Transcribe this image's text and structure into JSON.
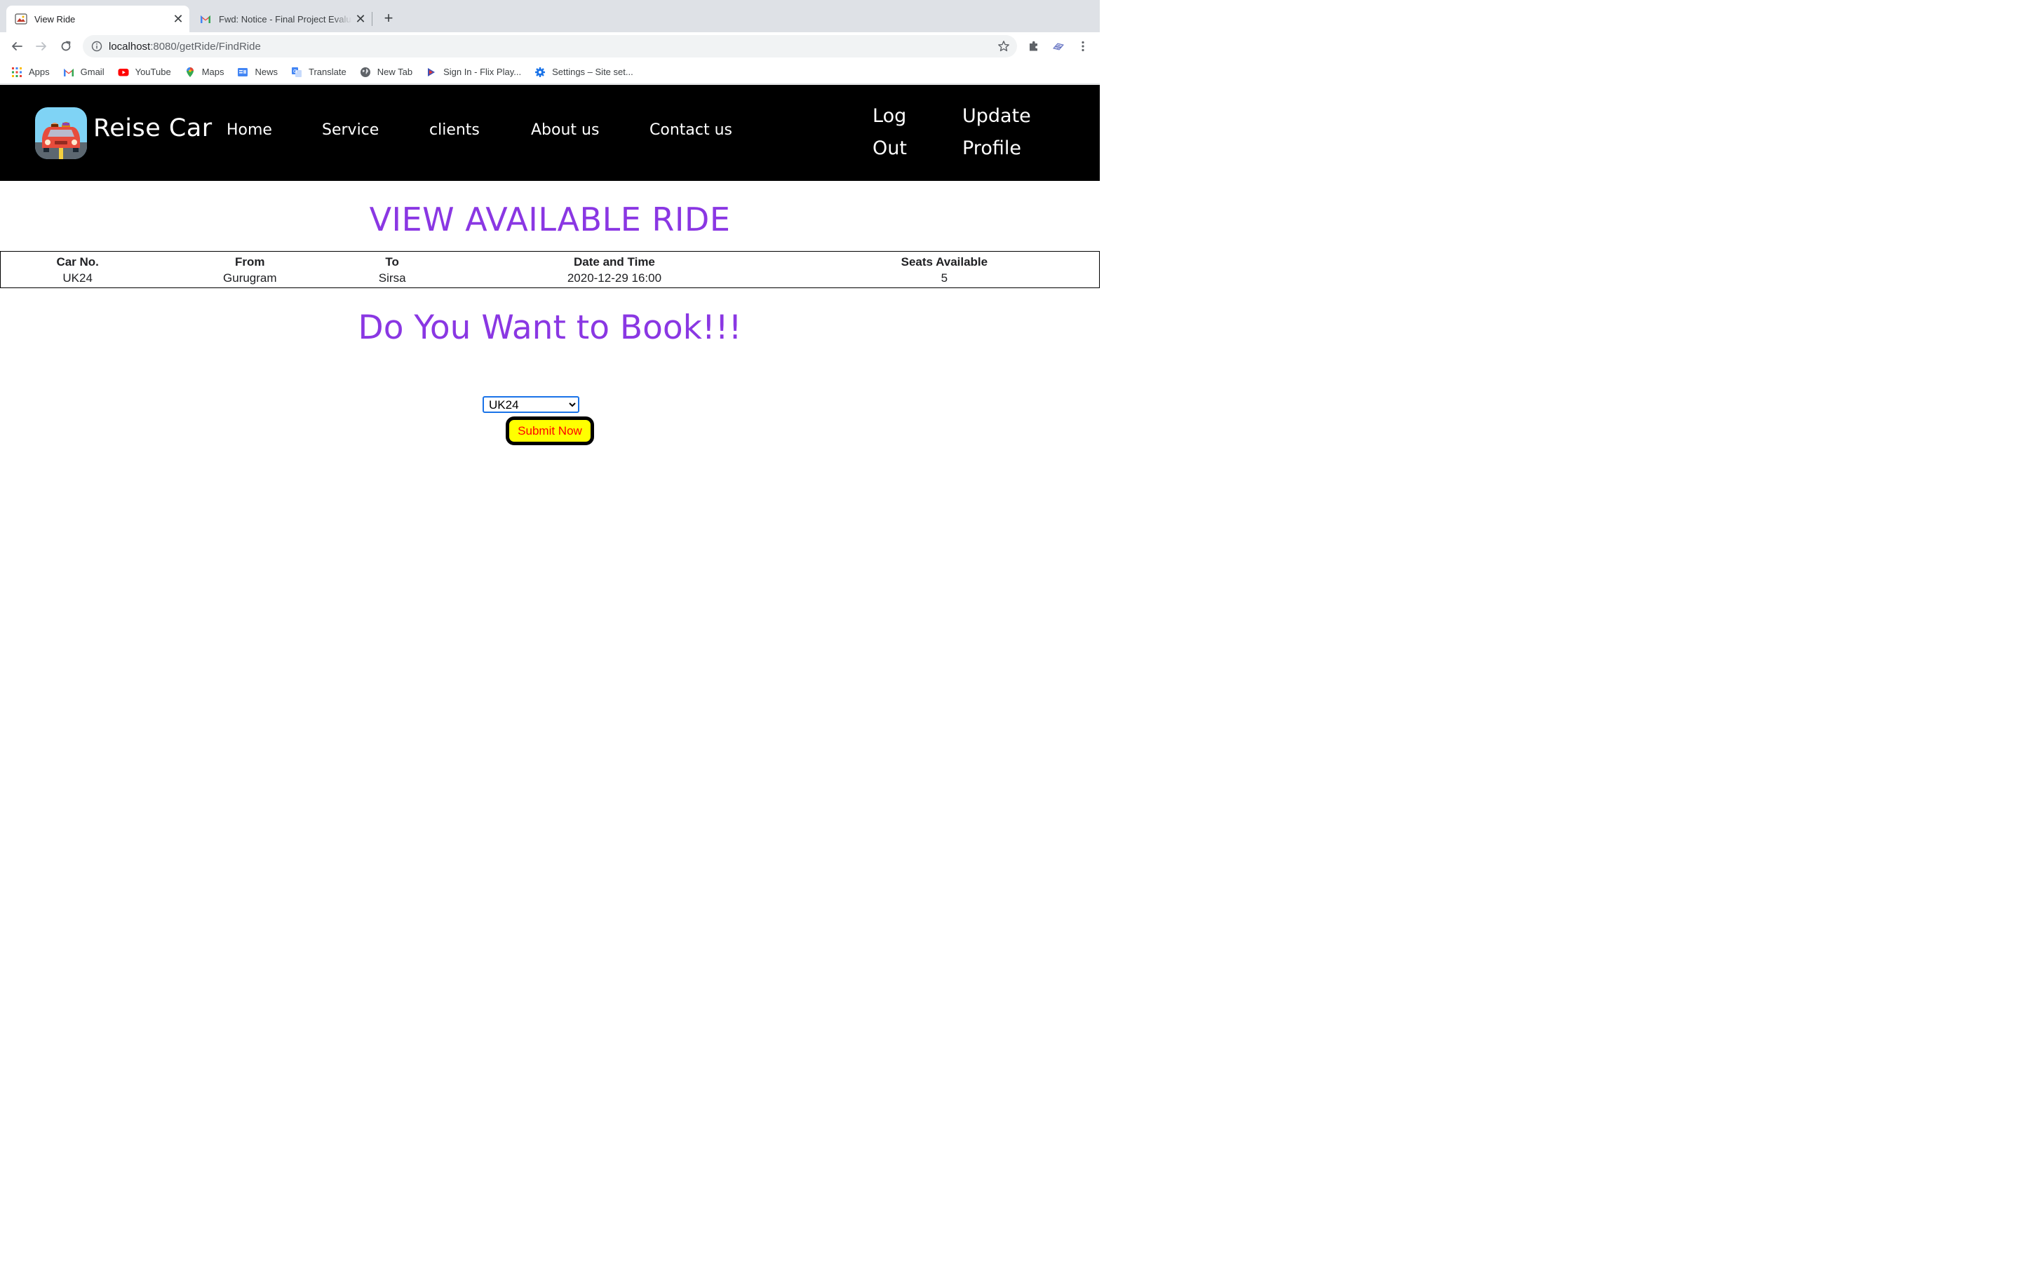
{
  "browser": {
    "tabs": [
      {
        "title": "View Ride",
        "active": true
      },
      {
        "title": "Fwd: Notice - Final Project Evaluation",
        "active": false
      }
    ],
    "url_host": "localhost",
    "url_rest": ":8080/getRide/FindRide",
    "bookmarks": [
      {
        "label": "Apps",
        "icon": "apps-grid-icon"
      },
      {
        "label": "Gmail",
        "icon": "gmail-icon"
      },
      {
        "label": "YouTube",
        "icon": "youtube-icon"
      },
      {
        "label": "Maps",
        "icon": "maps-pin-icon"
      },
      {
        "label": "News",
        "icon": "news-icon"
      },
      {
        "label": "Translate",
        "icon": "translate-icon"
      },
      {
        "label": "New Tab",
        "icon": "globe-icon"
      },
      {
        "label": "Sign In - Flix Play...",
        "icon": "flix-play-icon"
      },
      {
        "label": "Settings – Site set...",
        "icon": "settings-gear-icon"
      }
    ]
  },
  "site": {
    "brand": "Reise Car",
    "nav": {
      "home": "Home",
      "service": "Service",
      "clients": "clients",
      "about": "About us",
      "contact": "Contact us",
      "logout_line1": "Log",
      "logout_line2": "Out",
      "update_line1": "Update",
      "update_line2": "Profile"
    }
  },
  "main": {
    "title": "VIEW AVAILABLE RIDE",
    "table": {
      "headers": [
        "Car No.",
        "From",
        "To",
        "Date and Time",
        "Seats Available"
      ],
      "rows": [
        [
          "UK24",
          "Gurugram",
          "Sirsa",
          "2020-12-29 16:00",
          "5"
        ]
      ]
    },
    "book_prompt": "Do You Want to Book!!!",
    "select": {
      "selected": "UK24",
      "options": [
        "UK24"
      ]
    },
    "submit_label": "Submit Now"
  },
  "colors": {
    "heading": "#8a37e3",
    "header_bg": "#000000",
    "button_bg": "#ffff00",
    "button_text": "#ff0000"
  }
}
